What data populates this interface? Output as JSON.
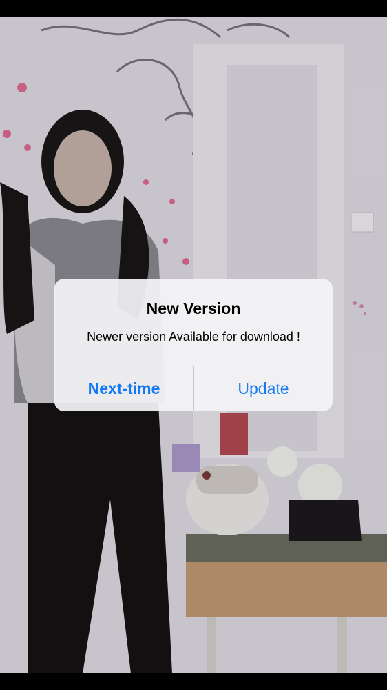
{
  "alert": {
    "title": "New Version",
    "message": "Newer version Available for download !",
    "buttons": {
      "next_time": "Next-time",
      "update": "Update"
    }
  },
  "colors": {
    "button_text": "#1479f4",
    "alert_background": "#f4f4f6",
    "letterbox": "#000000"
  }
}
